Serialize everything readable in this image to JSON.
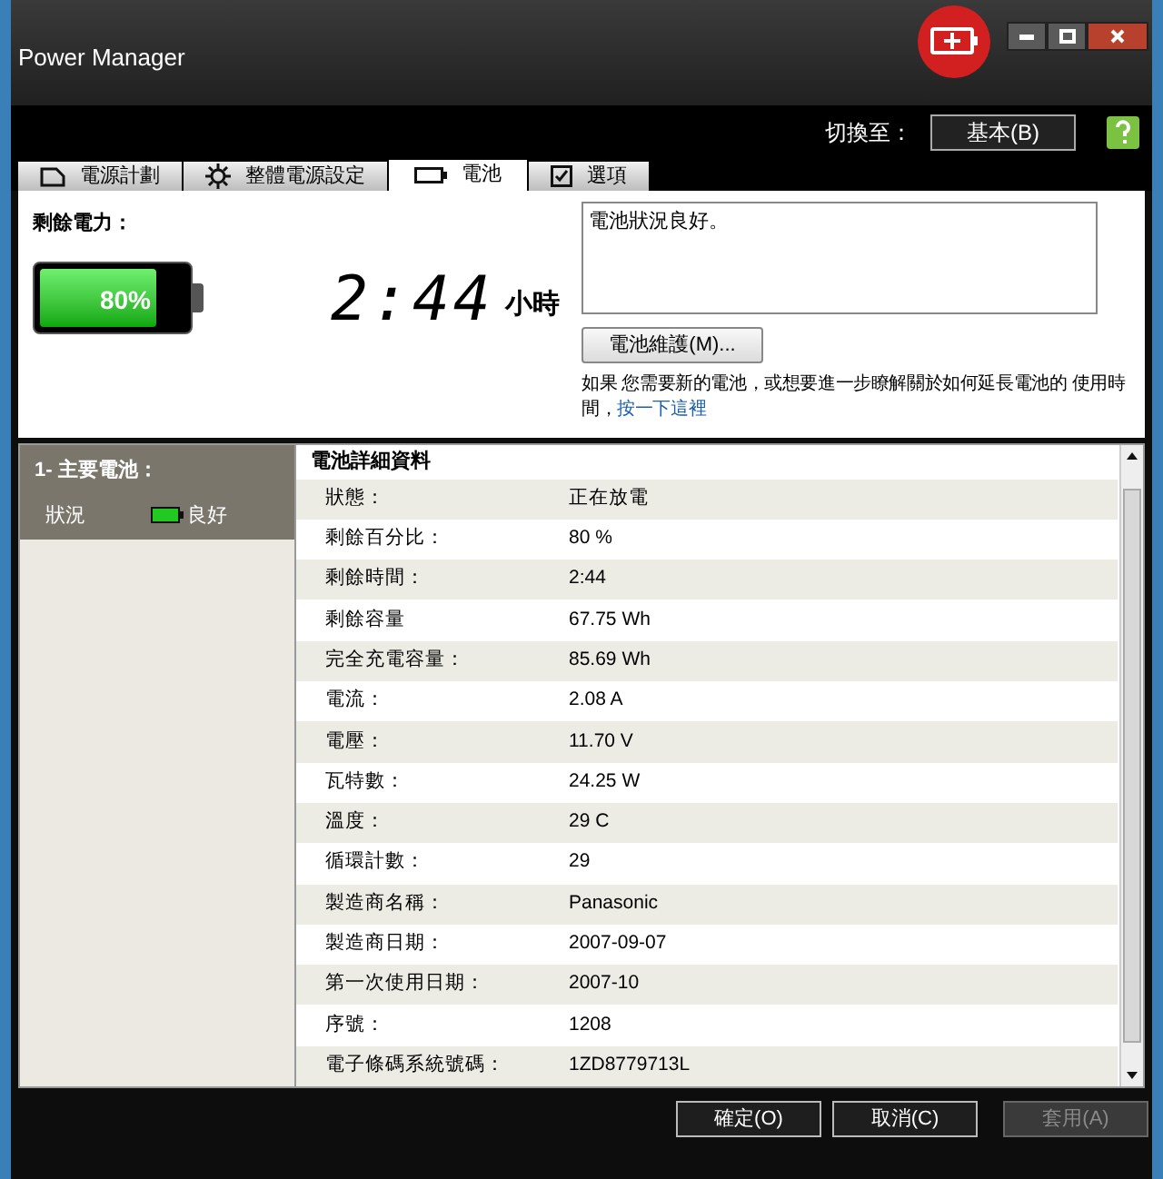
{
  "window": {
    "title": "Power Manager"
  },
  "switch": {
    "label": "切換至：",
    "button": "基本(B)"
  },
  "tabs": [
    {
      "label": "電源計劃",
      "kind": "plan",
      "selected": false
    },
    {
      "label": "整體電源設定",
      "kind": "gear",
      "selected": false
    },
    {
      "label": "電池",
      "kind": "battery",
      "selected": true
    },
    {
      "label": "選項",
      "kind": "check",
      "selected": false
    }
  ],
  "remaining": {
    "label": "剩餘電力：",
    "percent": "80%",
    "level": 0.8,
    "time": "2:44",
    "unit": "小時"
  },
  "status_text": "電池狀況良好。",
  "maintenance_button": "電池維護(M)...",
  "hint": {
    "text": "如果 您需要新的電池，或想要進一步瞭解關於如何延長電池的 使用時間，",
    "link": "按一下這裡"
  },
  "battery_list": {
    "header": "1- 主要電池：",
    "status_label": "狀況",
    "status_value": "良好"
  },
  "details": {
    "title": "電池詳細資料",
    "rows": [
      {
        "label": "狀態：",
        "value": "正在放電"
      },
      {
        "label": "剩餘百分比：",
        "value": "80 %"
      },
      {
        "label": "剩餘時間：",
        "value": "2:44"
      },
      {
        "label": "剩餘容量",
        "value": "67.75 Wh"
      },
      {
        "label": "完全充電容量：",
        "value": "85.69 Wh"
      },
      {
        "label": "電流：",
        "value": "2.08 A"
      },
      {
        "label": "電壓：",
        "value": "11.70 V"
      },
      {
        "label": "瓦特數：",
        "value": "24.25 W"
      },
      {
        "label": "溫度：",
        "value": "29 C"
      },
      {
        "label": "循環計數：",
        "value": "29"
      },
      {
        "label": "製造商名稱：",
        "value": "Panasonic"
      },
      {
        "label": "製造商日期：",
        "value": "2007-09-07"
      },
      {
        "label": "第一次使用日期：",
        "value": "2007-10"
      },
      {
        "label": "序號：",
        "value": "1208"
      },
      {
        "label": "電子條碼系統號碼：",
        "value": "1ZD8779713L"
      }
    ]
  },
  "buttons": [
    {
      "label": "確定(O)",
      "disabled": false
    },
    {
      "label": "取消(C)",
      "disabled": false
    },
    {
      "label": "套用(A)",
      "disabled": true
    }
  ]
}
